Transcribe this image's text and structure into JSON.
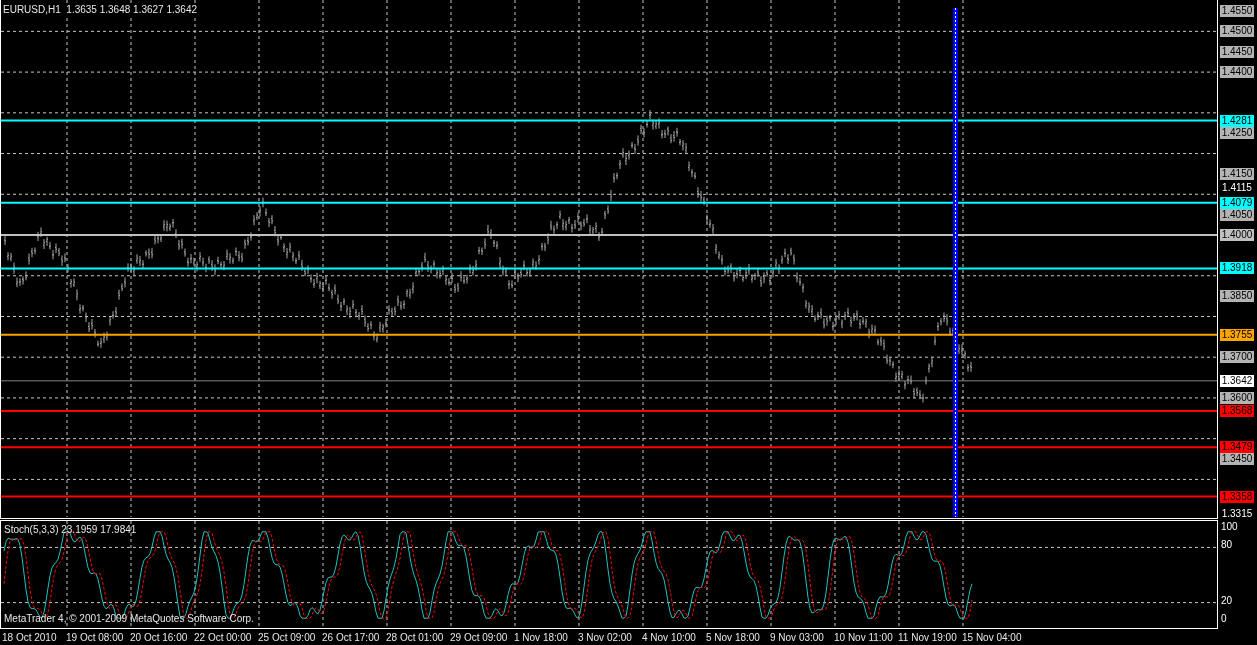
{
  "symbol": {
    "title": "EURUSD,H1",
    "quote": "1.3635 1.3648 1.3627 1.3642"
  },
  "levels": [
    {
      "label": "1.4281",
      "color": "#00ffff"
    },
    {
      "label": "1.4079",
      "color": "#00ffff"
    },
    {
      "label": "1.4000",
      "color": "#c0c0c0"
    },
    {
      "label": "1.3918",
      "color": "#00ffff"
    },
    {
      "label": "1.3755",
      "color": "#ffa500"
    },
    {
      "label": "1.3568",
      "color": "#ff0000"
    },
    {
      "label": "1.3479",
      "color": "#ff0000"
    },
    {
      "label": "1.3358",
      "color": "#ff0000"
    }
  ],
  "current_price": {
    "label": "1.3642"
  },
  "price_axis": [
    {
      "label": "1.4550",
      "kind": "grid"
    },
    {
      "label": "1.4500",
      "kind": "grid"
    },
    {
      "label": "1.4450",
      "kind": "grid"
    },
    {
      "label": "1.4400",
      "kind": "grid"
    },
    {
      "label": "1.4250",
      "kind": "grid"
    },
    {
      "label": "1.4150",
      "kind": "grid"
    },
    {
      "label": "1.4115",
      "kind": "tick"
    },
    {
      "label": "1.4050",
      "kind": "grid"
    },
    {
      "label": "1.3850",
      "kind": "grid"
    },
    {
      "label": "1.3700",
      "kind": "grid"
    },
    {
      "label": "1.3600",
      "kind": "grid"
    },
    {
      "label": "1.3450",
      "kind": "grid"
    },
    {
      "label": "1.3315",
      "kind": "tick"
    }
  ],
  "indicator": {
    "title": "Stoch(5,3,3) 23.1959 17.9841",
    "scale": [
      "100",
      "80",
      "20",
      "0"
    ]
  },
  "copyright": "MetaTrader 4, © 2001-2009 MetaQuotes Software Corp.",
  "time_axis": [
    "18 Oct 2010",
    "19 Oct 08:00",
    "20 Oct 16:00",
    "22 Oct 00:00",
    "25 Oct 09:00",
    "26 Oct 17:00",
    "28 Oct 01:00",
    "29 Oct 09:00",
    "1 Nov 18:00",
    "3 Nov 02:00",
    "4 Nov 10:00",
    "5 Nov 18:00",
    "9 Nov 03:00",
    "10 Nov 11:00",
    "11 Nov 19:00",
    "15 Nov 04:00"
  ]
}
